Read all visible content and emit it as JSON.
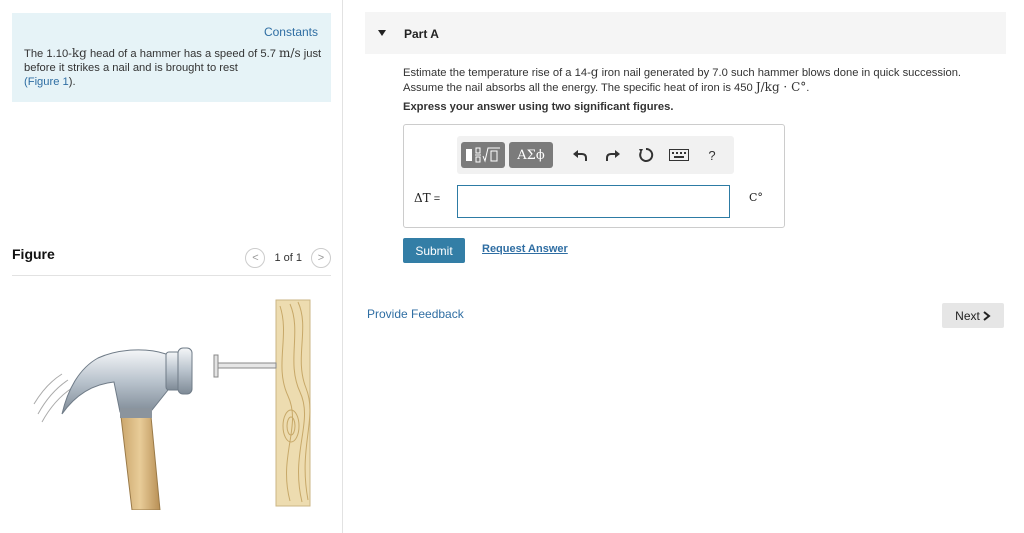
{
  "left_panel": {
    "constants_link": "Constants",
    "problem_part1": "The 1.10-",
    "problem_unit_kg": "kg",
    "problem_part2": " head of a hammer has a speed of 5.7 ",
    "problem_unit_speed": "m/s",
    "problem_part3": " just before it strikes a nail and is brought to rest",
    "figure_link_open": "(",
    "figure_link": "Figure 1",
    "figure_link_close": ").",
    "figure_heading": "Figure",
    "pager": {
      "prev_symbol": "<",
      "count": "1 of 1",
      "next_symbol": ">"
    }
  },
  "part_a": {
    "title": "Part A",
    "question_part1": "Estimate the temperature rise of a 14-",
    "question_unit_g": "g",
    "question_part2": " iron nail generated by 7.0 such hammer blows done in quick succession. Assume the nail absorbs all the energy. The specific heat of iron is 450 ",
    "question_unit_heat": "J/kg · C°",
    "question_end": ".",
    "instruction": "Express your answer using two significant figures.",
    "toolbar": {
      "template_icon": "fraction-sqrt-template-icon",
      "greek_label": "ΑΣϕ",
      "undo_icon": "undo-icon",
      "redo_icon": "redo-icon",
      "reset_icon": "reset-icon",
      "keyboard_icon": "keyboard-icon",
      "help_label": "?"
    },
    "input_label_symbol": "ΔT",
    "input_label_eq": " =",
    "input_value": "",
    "unit_label": "C°",
    "submit_label": "Submit",
    "request_answer_label": "Request Answer"
  },
  "footer": {
    "feedback_label": "Provide Feedback",
    "next_label": "Next",
    "next_icon": "chevron-right-icon"
  },
  "colors": {
    "link": "#2f6ea3",
    "submit_bg": "#337ea6",
    "info_bg": "#e6f3f7",
    "input_border": "#2d7ba4"
  }
}
